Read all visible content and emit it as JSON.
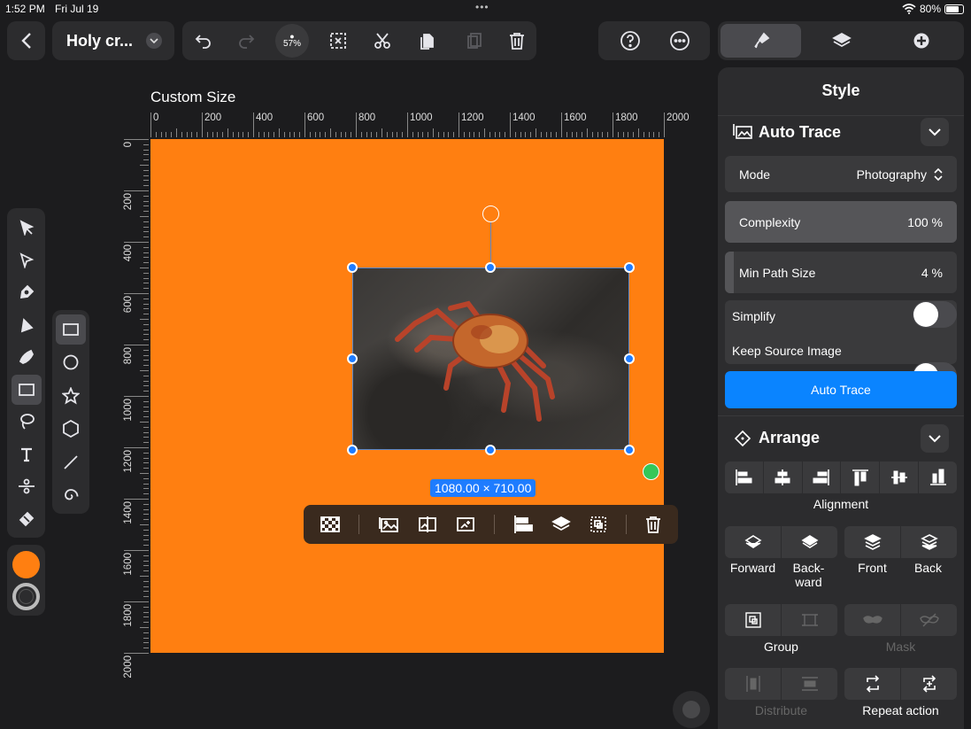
{
  "status": {
    "time": "1:52 PM",
    "date": "Fri Jul 19",
    "battery": "80%"
  },
  "topbar": {
    "back_icon": "chevron-left-icon",
    "doc_title": "Holy cr...",
    "zoom": "57%"
  },
  "ruler": {
    "caption": "Custom Size",
    "h_ticks": [
      "0",
      "200",
      "400",
      "600",
      "800",
      "1000",
      "1200",
      "1400",
      "1600",
      "1800",
      "2000"
    ],
    "v_ticks": [
      "0",
      "200",
      "400",
      "600",
      "800",
      "1000",
      "1200",
      "1400",
      "1600",
      "1800",
      "2000"
    ]
  },
  "canvas": {
    "background": "#ff7f11",
    "selection_size": "1080.00 × 710.00"
  },
  "colors": {
    "fill": "#ff7f11",
    "accent": "#1e7cff",
    "button_blue": "#0a84ff"
  },
  "panel": {
    "title": "Style",
    "auto_trace": {
      "title": "Auto Trace",
      "mode_label": "Mode",
      "mode_value": "Photography",
      "complexity_label": "Complexity",
      "complexity_value": "100 %",
      "complexity_fraction": 1.0,
      "min_path_label": "Min Path Size",
      "min_path_value": "4 %",
      "min_path_fraction": 0.04,
      "simplify_label": "Simplify",
      "simplify_on": false,
      "keep_source_label": "Keep Source Image",
      "keep_source_on": false,
      "button_label": "Auto Trace"
    },
    "arrange": {
      "title": "Arrange",
      "alignment_label": "Alignment",
      "forward_label": "Forward",
      "backward_label": "Back-\nward",
      "front_label": "Front",
      "back_label": "Back",
      "group_label": "Group",
      "mask_label": "Mask",
      "distribute_label": "Distribute",
      "repeat_label": "Repeat action"
    }
  }
}
